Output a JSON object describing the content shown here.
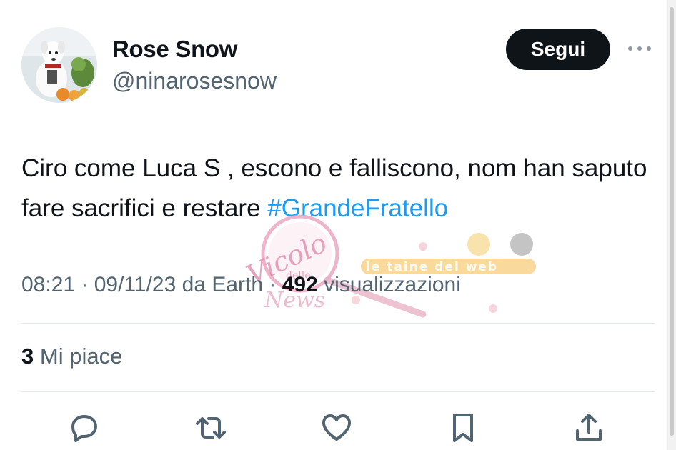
{
  "author": {
    "display_name": "Rose Snow",
    "handle": "@ninarosesnow",
    "avatar_icon": "dog-avatar"
  },
  "follow_label": "Segui",
  "more_icon": "ellipsis-icon",
  "tweet": {
    "text": "Ciro come Luca S , escono e falliscono, nom han saputo fare sacrifici e restare ",
    "hashtag": "#GrandeFratello"
  },
  "meta": {
    "time": "08:21",
    "separator": " · ",
    "date_source": "09/11/23 da Earth",
    "views_count": "492",
    "views_label": "visualizzazioni"
  },
  "likes": {
    "count": "3",
    "label": "Mi piace"
  },
  "actions": [
    {
      "icon": "reply-icon"
    },
    {
      "icon": "retweet-icon"
    },
    {
      "icon": "like-icon"
    },
    {
      "icon": "bookmark-icon"
    },
    {
      "icon": "share-icon"
    }
  ],
  "watermark": {
    "logo_text": "Vicolo delle News",
    "banner_text": "le taine del web"
  },
  "colors": {
    "text": "#0f1419",
    "secondary": "#536471",
    "hashtag": "#1d9bf0",
    "follow_bg": "#0f1419"
  }
}
